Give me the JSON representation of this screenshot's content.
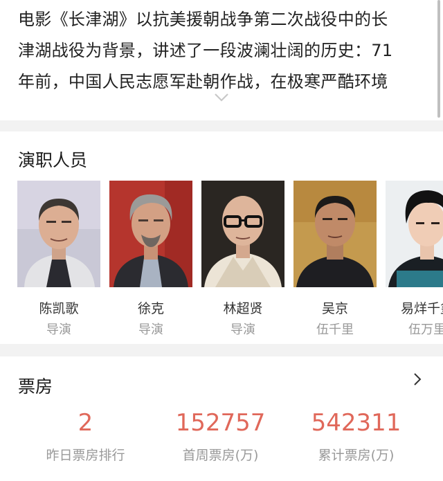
{
  "synopsis": {
    "lines": [
      "电影《长津湖》以抗美援朝战争第二次战役中的长",
      "津湖战役为背景，讲述了一段波澜壮阔的历史：71",
      "年前，中国人民志愿军赴朝作战，在极寒严酷环境"
    ],
    "expand_icon": "chevron-down-icon"
  },
  "cast": {
    "title": "演职人员",
    "members": [
      {
        "name": "陈凯歌",
        "role": "导演"
      },
      {
        "name": "徐克",
        "role": "导演"
      },
      {
        "name": "林超贤",
        "role": "导演"
      },
      {
        "name": "吴京",
        "role": "伍千里"
      },
      {
        "name": "易烊千玺",
        "role": "伍万里"
      }
    ]
  },
  "box_office": {
    "title": "票房",
    "more_icon": "chevron-right-icon",
    "accent_color": "#e0685a",
    "stats": [
      {
        "value": "2",
        "label": "昨日票房排行"
      },
      {
        "value": "152757",
        "label": "首周票房(万)"
      },
      {
        "value": "542311",
        "label": "累计票房(万)"
      }
    ]
  }
}
